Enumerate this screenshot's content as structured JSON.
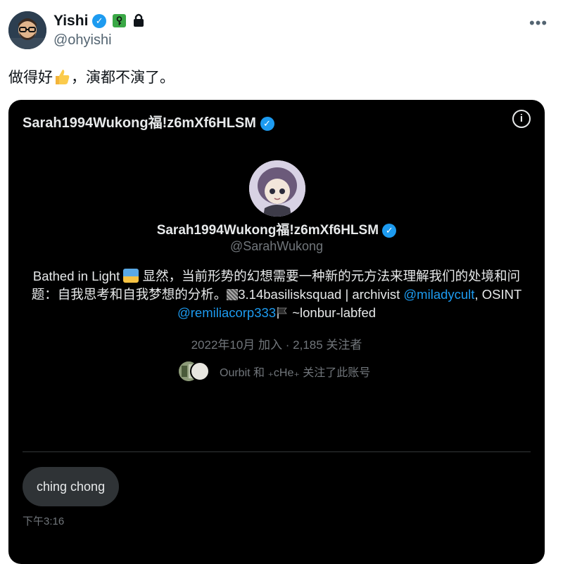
{
  "author": {
    "name": "Yishi",
    "handle": "@ohyishi"
  },
  "tweet": {
    "text_before": "做得好",
    "text_after": "，演都不演了。"
  },
  "card": {
    "title": "Sarah1994Wukong福!z6mXf6HLSM",
    "profile_name": "Sarah1994Wukong福!z6mXf6HLSM",
    "profile_handle": "@SarahWukong",
    "bio": {
      "part1": "Bathed in Light ",
      "part2": " 显然，当前形势的幻想需要一种新的元方法来理解我们的处境和问题：自我思考和自我梦想的分析。",
      "part3": "3.14basilisksquad | archivist ",
      "link1": "@miladycult",
      "part4": ", OSINT ",
      "link2": "@remiliacorp333",
      "part5": " ~lonbur-labfed"
    },
    "joined": "2022年10月 加入 · 2,185 关注者",
    "followed_by": "Ourbit 和 ₊cHe₊ 关注了此账号",
    "message": "ching chong",
    "message_time": "下午3:16"
  },
  "colors": {
    "verified": "#1d9bf0",
    "link": "#1d9bf0",
    "card_bg": "#000000"
  }
}
